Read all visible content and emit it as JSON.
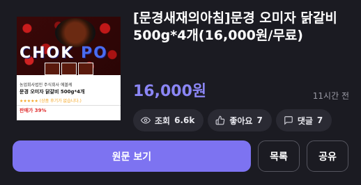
{
  "post": {
    "title": "[문경새재의아침]문경 오미자 닭갈비 500g*4개(16,000원/무료)",
    "price": "16,000원",
    "time_ago": "11시간 전"
  },
  "thumbnail": {
    "logo_main": "CHOK",
    "logo_accent": "PO",
    "seller": "농업회사법인 주식회사 에볼케",
    "product_title": "문경 오미자 닭갈비 500g*4개",
    "rating_text": "★★★★★ (상품 후기가 없습니다.)",
    "price_text": "판매가 39%"
  },
  "stats": {
    "views_label": "조회",
    "views_value": "6.6k",
    "likes_label": "좋아요",
    "likes_value": "7",
    "comments_label": "댓글",
    "comments_value": "7"
  },
  "actions": {
    "view_original": "원문 보기",
    "list": "목록",
    "share": "공유"
  },
  "colors": {
    "background": "#1b1b22",
    "accent": "#7d73f1",
    "price": "#8b86f5",
    "chip": "#2a2a33"
  }
}
